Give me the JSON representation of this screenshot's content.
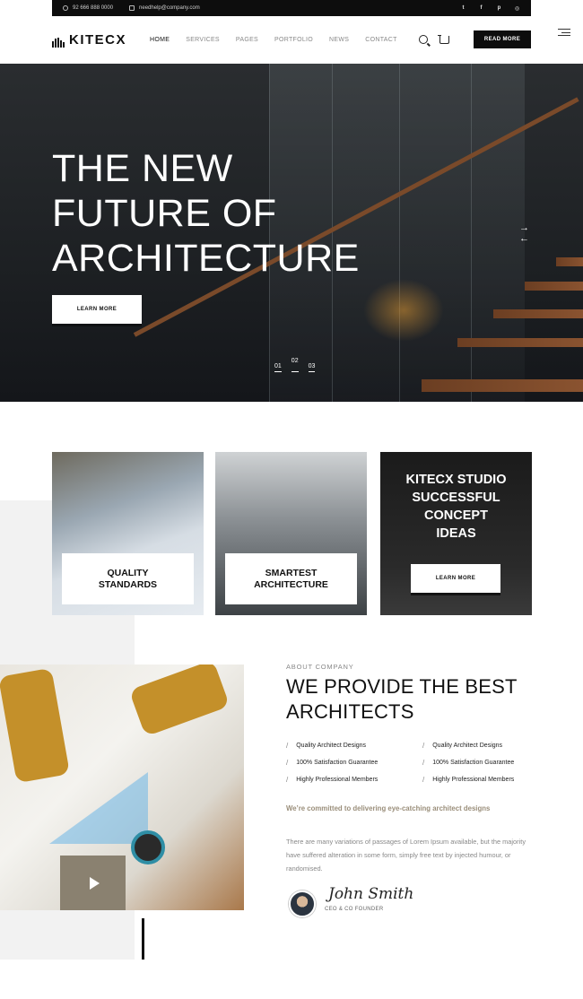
{
  "topbar": {
    "phone": "92 666 888 0000",
    "email": "needhelp@company.com",
    "socials": [
      "twitter-icon",
      "facebook-icon",
      "pinterest-icon",
      "instagram-icon"
    ]
  },
  "header": {
    "logo": "KITECX",
    "nav": [
      "HOME",
      "SERVICES",
      "PAGES",
      "PORTFOLIO",
      "NEWS",
      "CONTACT"
    ],
    "active_nav": "HOME",
    "cta": "READ MORE"
  },
  "hero": {
    "title_line1": "THE NEW",
    "title_line2": "FUTURE OF",
    "title_line3": "ARCHITECTURE",
    "button": "LEARN MORE",
    "slides": [
      "01",
      "02",
      "03"
    ],
    "active_slide": "02"
  },
  "services": {
    "card1_label_line1": "QUALITY",
    "card1_label_line2": "STANDARDS",
    "card2_label_line1": "SMARTEST",
    "card2_label_line2": "ARCHITECTURE",
    "card3_title_line1": "KITECX STUDIO",
    "card3_title_line2": "SUCCESSFUL",
    "card3_title_line3": "CONCEPT",
    "card3_title_line4": "IDEAS",
    "card3_button": "LEARN MORE"
  },
  "about": {
    "eyebrow": "ABOUT COMPANY",
    "heading_line1": "WE PROVIDE THE BEST",
    "heading_line2": "ARCHITECTS",
    "features": [
      "Quality Architect Designs",
      "Quality Architect Designs",
      "100% Satisfaction Guarantee",
      "100% Satisfaction Guarantee",
      "Highly Professional Members",
      "Highly Professional Members"
    ],
    "tagline": "We’re committed to delivering eye-catching architect designs",
    "paragraph": "There are many variations of passages of Lorem Ipsum available, but the majority have suffered alteration in some form, simply free text by injected humour, or randomised.",
    "signature": "John Smith",
    "role": "CEO & CO FOUNDER"
  },
  "colors": {
    "accent": "#9a8e7a",
    "dark": "#0d0d0d",
    "play_bg": "#8a8170"
  }
}
